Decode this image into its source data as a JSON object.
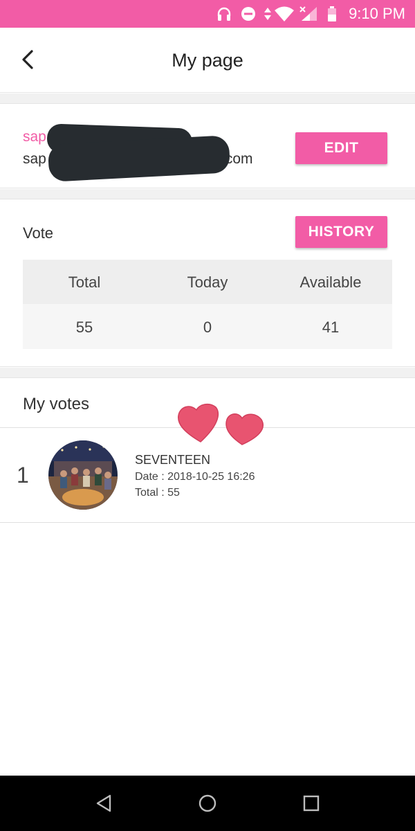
{
  "status_bar": {
    "time": "9:10 PM",
    "background": "#f25ca6",
    "icons": [
      "headphones-icon",
      "do-not-disturb-icon",
      "data-arrows-icon",
      "wifi-icon",
      "cell-signal-icon",
      "battery-icon"
    ]
  },
  "header": {
    "title": "My page",
    "back_icon": "chevron-left-icon"
  },
  "profile": {
    "name": "sap",
    "email_prefix": "sap",
    "email_suffix": ".com",
    "edit_label": "EDIT"
  },
  "vote": {
    "label": "Vote",
    "history_label": "HISTORY",
    "columns": [
      "Total",
      "Today",
      "Available"
    ],
    "values": [
      "55",
      "0",
      "41"
    ]
  },
  "my_votes": {
    "title": "My votes",
    "items": [
      {
        "rank": "1",
        "artist": "SEVENTEEN",
        "date": "Date : 2018-10-25 16:26",
        "total": "Total : 55"
      }
    ]
  },
  "nav": {
    "icons": [
      "back-triangle-icon",
      "home-circle-icon",
      "recents-square-icon"
    ]
  },
  "colors": {
    "accent": "#f25ca6",
    "heart": "#e85470",
    "redaction": "#272c30"
  }
}
